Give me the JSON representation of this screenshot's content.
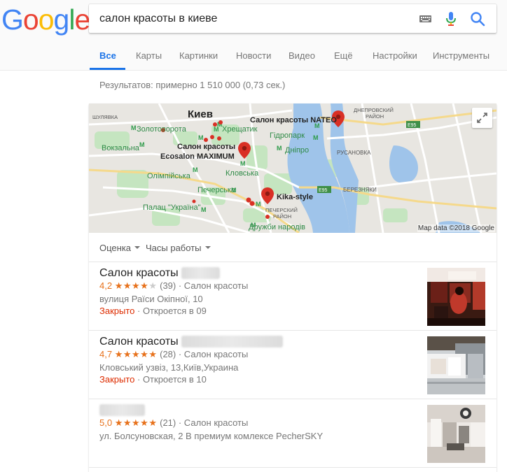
{
  "logo": {
    "letters": [
      "G",
      "o",
      "o",
      "g",
      "l",
      "e"
    ],
    "colors": [
      "#4285f4",
      "#ea4335",
      "#fbbc05",
      "#4285f4",
      "#34a853",
      "#ea4335"
    ]
  },
  "search": {
    "query": "салон красоты в киеве"
  },
  "icons": {
    "keyboard": "keyboard-icon",
    "mic": "microphone-icon",
    "search": "search-icon",
    "expand": "expand-icon",
    "map_pin": "map-pin-icon"
  },
  "accent_color": "#1a73e8",
  "tabs": [
    {
      "label": "Все",
      "active": true
    },
    {
      "label": "Карты"
    },
    {
      "label": "Картинки"
    },
    {
      "label": "Новости"
    },
    {
      "label": "Видео"
    },
    {
      "label": "Ещё"
    },
    {
      "label": "Настройки"
    },
    {
      "label": "Инструменты"
    }
  ],
  "result_stats": "Результатов: примерно 1 510 000 (0,73 сек.)",
  "map": {
    "labels": {
      "kiev": "Киев",
      "shulyavka": "ШУЛЯВКА",
      "zolotovorota": "Золотоворота",
      "khreshchatyk": "Хрещатик",
      "vokzalna": "Вокзальна",
      "gidropark": "Гідропарк",
      "dnipro": "Дніпро",
      "olimpiyska": "Олімпійська",
      "klovska": "Кловська",
      "pecherska": "Печерська",
      "palats": "Палац \"Україна\"",
      "pechersky_line1": "ПЕЧЕРСКИЙ",
      "pechersky_line2": "РАЙОН",
      "druzhby": "Дружби народів",
      "dniprovsky_line1": "ДНЕПРОВСКИЙ",
      "dniprovsky_line2": "РАЙОН",
      "rusanovka": "РУСАНОВКА",
      "berezniaki": "БЕРЕЗНЯКИ",
      "e95_a": "E95",
      "e95_b": "E95",
      "pin1": "Салон красоты NATEO",
      "pin2_line1": "Салон красоты",
      "pin2_line2": "Ecosalon MAXIMUM",
      "pin3": "Kika-style"
    },
    "attribution": "Map data ©2018 Google"
  },
  "filters": [
    "Оценка",
    "Часы работы"
  ],
  "listings": [
    {
      "name": "Салон красоты",
      "rating": "4,2",
      "stars": 4,
      "reviews": "(39)",
      "category": "· Салон красоты",
      "address": "вулиця Раїси Окіпної, 10",
      "status": "Закрыто",
      "hours": " · Откроется в 09"
    },
    {
      "name": "Салон красоты",
      "rating": "4,7",
      "stars": 4.7,
      "reviews": "(28)",
      "category": "· Салон красоты",
      "address": "Кловський узвіз, 13,Київ,Украина",
      "status": "Закрыто",
      "hours": " · Откроется в 10"
    },
    {
      "name": "",
      "rating": "5,0",
      "stars": 5,
      "reviews": "(21)",
      "category": "· Салон красоты",
      "address": "ул. Болсуновская, 2 В премиум комлексе PecherSKY"
    }
  ]
}
